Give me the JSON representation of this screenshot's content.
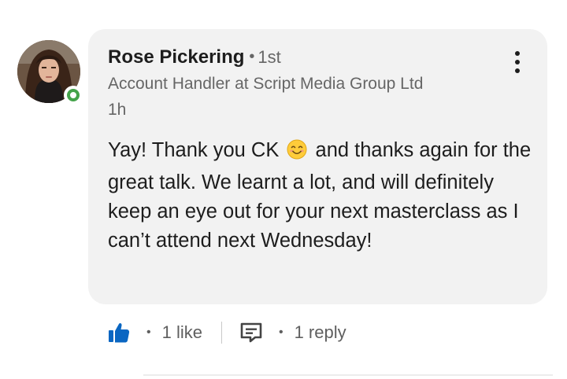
{
  "comment": {
    "author": "Rose Pickering",
    "connection_degree": "1st",
    "headline": "Account Handler at Script Media Group Ltd",
    "timestamp": "1h",
    "message_part1": "Yay! Thank you CK",
    "message_part2": "and thanks again for the great talk. We learnt a lot, and will definitely keep an eye out for your next masterclass as I can’t attend next Wednesday!",
    "status": "online"
  },
  "icons": {
    "menu": "more-vertical-icon",
    "emoji": "smiling-face-emoji",
    "like": "thumbs-up-icon",
    "reply": "comment-icon"
  },
  "actions": {
    "likes": "1 like",
    "replies": "1 reply"
  },
  "colors": {
    "bubble_bg": "#f2f2f2",
    "like_blue": "#0a66c2",
    "presence_green": "#44a34a",
    "text_primary": "#1d1d1d",
    "text_secondary": "#666666"
  }
}
